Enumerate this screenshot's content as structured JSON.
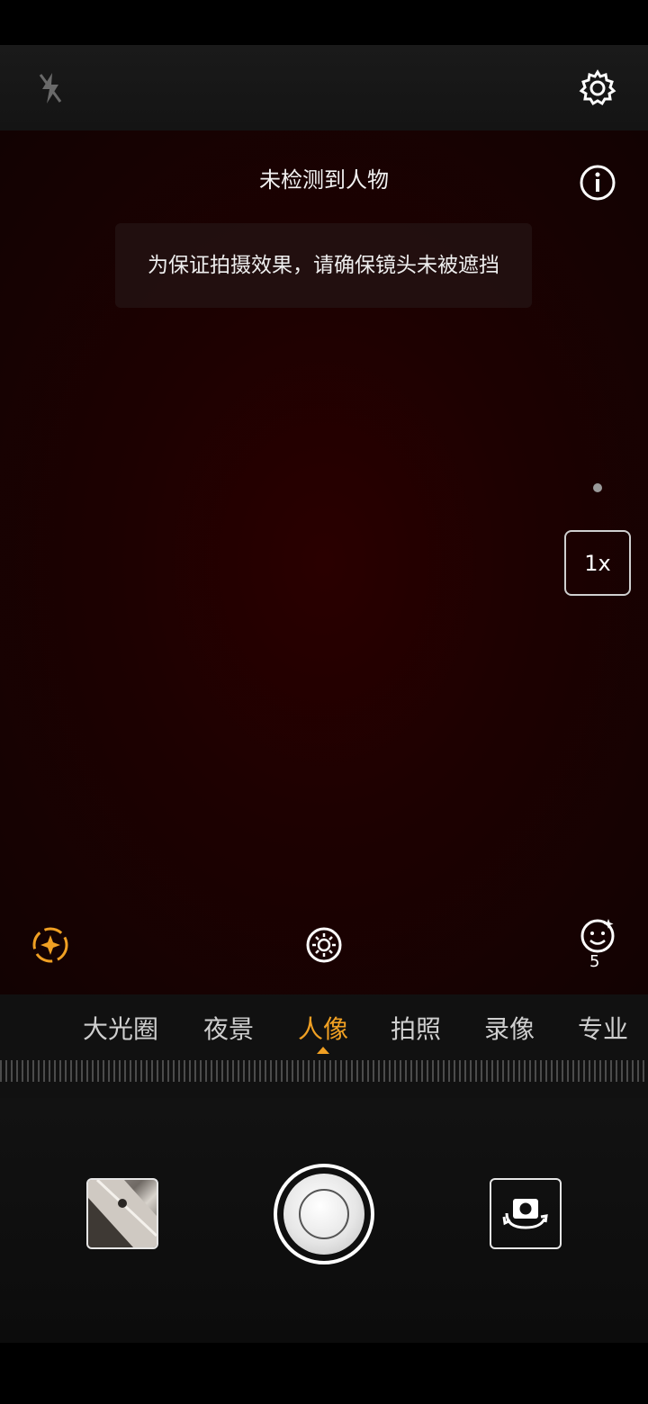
{
  "top": {
    "flash_icon": "flash-off-icon",
    "settings_icon": "gear-icon"
  },
  "viewfinder": {
    "status_text": "未检测到人物",
    "tip_text": "为保证拍摄效果，请确保镜头未被遮挡",
    "info_icon": "info-icon",
    "zoom_label": "1x"
  },
  "effects": {
    "ai_icon": "sparkle-icon",
    "filter_icon": "aperture-icon",
    "beauty_icon": "face-icon",
    "beauty_level": "5"
  },
  "modes": {
    "items": [
      {
        "label": "大光圈"
      },
      {
        "label": "夜景"
      },
      {
        "label": "人像"
      },
      {
        "label": "拍照"
      },
      {
        "label": "录像"
      },
      {
        "label": "专业"
      }
    ],
    "active": "人像"
  },
  "controls": {
    "gallery_icon": "gallery-thumbnail",
    "shutter_icon": "shutter-button",
    "switch_icon": "switch-camera-icon"
  },
  "colors": {
    "accent": "#f0a023",
    "viewfinder": "#1d0101"
  }
}
